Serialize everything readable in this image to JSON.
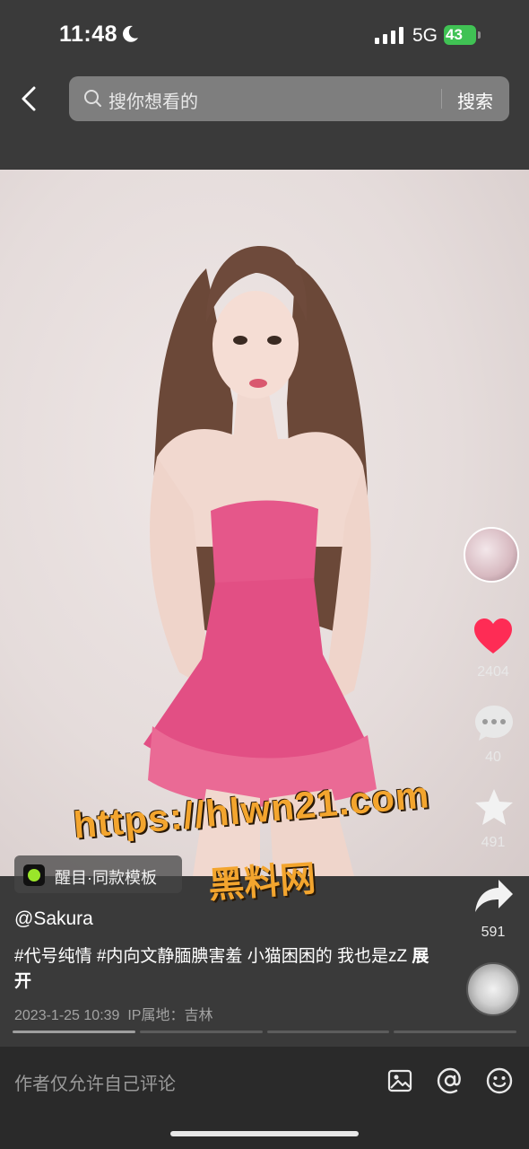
{
  "status_bar": {
    "time": "11:48",
    "network": "5G",
    "battery": "43"
  },
  "header": {
    "search_placeholder": "搜你想看的",
    "search_button": "搜索"
  },
  "video": {
    "template_label": "醒目·同款模板",
    "watermark_url": "https://hlwn21.com",
    "watermark_text": "黑料网"
  },
  "actions": {
    "likes": "2404",
    "comments": "40",
    "favorites": "491",
    "shares": "591"
  },
  "post": {
    "username": "@Sakura",
    "caption": "#代号纯情 #内向文静腼腆害羞 小猫困困的 我也是zZ ",
    "expand": "展开",
    "date": "2023-1-25 10:39",
    "ip_location": "IP属地：吉林"
  },
  "progress": {
    "segments": 4,
    "active_index": 0
  },
  "bottom_bar": {
    "comment_notice": "作者仅允许自己评论"
  },
  "colors": {
    "like_red": "#fe2c55",
    "battery_green": "#40c254",
    "watermark_orange": "#f3a52e"
  }
}
